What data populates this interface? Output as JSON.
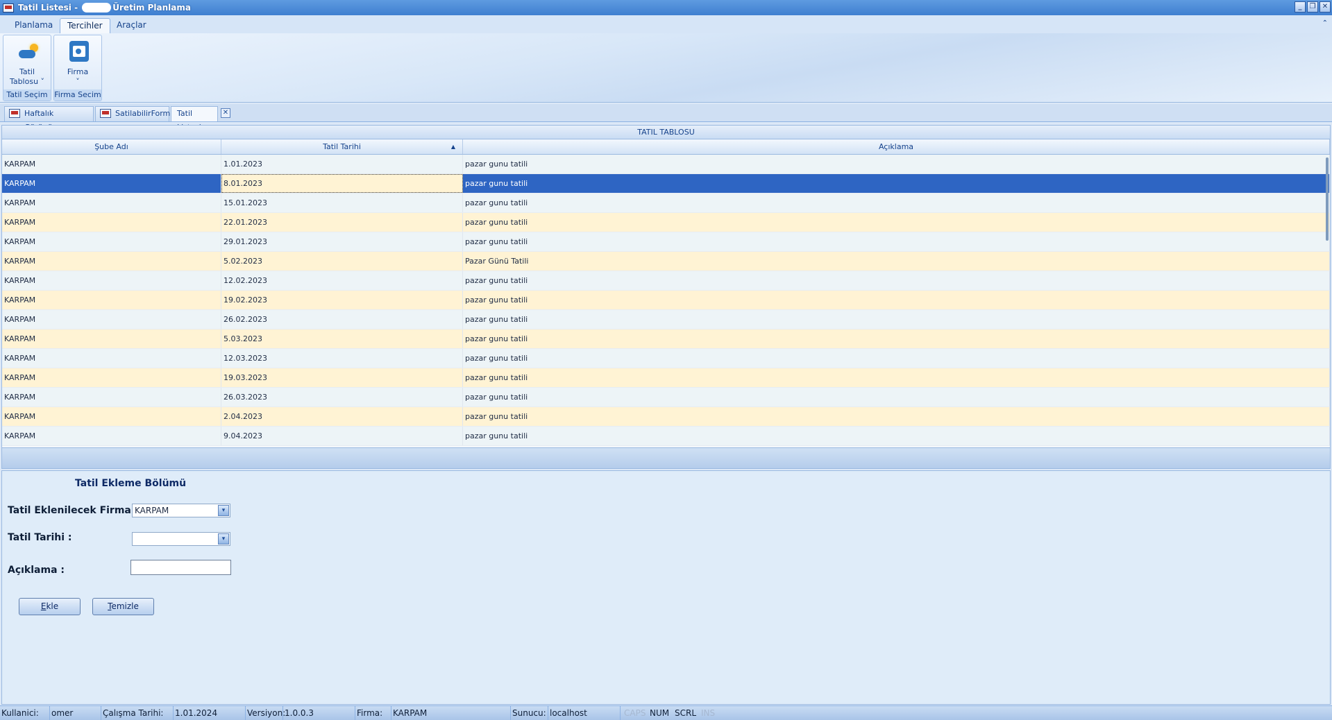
{
  "window": {
    "title_prefix": "Tatil Listesi -",
    "title_suffix": "Üretim Planlama",
    "minimize": "_",
    "restore": "❐",
    "close": "✕"
  },
  "ribbon": {
    "tabs": [
      "Planlama",
      "Tercihler",
      "Araçlar"
    ],
    "active_tab": "Tercihler",
    "collapse_glyph": "⌃",
    "groups": [
      {
        "button_line1": "Tatil",
        "button_line2": "Tablosu ˅",
        "label": "Tatil Seçim",
        "icon": "cloud-sun-icon"
      },
      {
        "button_line1": "Firma",
        "button_line2": "˅",
        "label": "Firma Secim",
        "icon": "company-document-icon"
      }
    ]
  },
  "doc_tabs": [
    {
      "label": "Haftalık Görünüm",
      "icon": "window-icon"
    },
    {
      "label": "SatilabilirForm",
      "icon": "window-icon"
    },
    {
      "label": "Tatil Listesi",
      "active": true
    }
  ],
  "doc_tab_close": "✕",
  "grid": {
    "title": "TATIL TABLOSU",
    "columns": [
      "Şube Adı",
      "Tatil Tarihi",
      "Açıklama"
    ],
    "sort_glyph": "▲",
    "selected_row": 1,
    "rows": [
      [
        "KARPAM",
        "1.01.2023",
        "pazar gunu tatili"
      ],
      [
        "KARPAM",
        "8.01.2023",
        "pazar gunu tatili"
      ],
      [
        "KARPAM",
        "15.01.2023",
        "pazar gunu tatili"
      ],
      [
        "KARPAM",
        "22.01.2023",
        "pazar gunu tatili"
      ],
      [
        "KARPAM",
        "29.01.2023",
        "pazar gunu tatili"
      ],
      [
        "KARPAM",
        "5.02.2023",
        "Pazar Günü Tatili"
      ],
      [
        "KARPAM",
        "12.02.2023",
        "pazar gunu tatili"
      ],
      [
        "KARPAM",
        "19.02.2023",
        "pazar gunu tatili"
      ],
      [
        "KARPAM",
        "26.02.2023",
        "pazar gunu tatili"
      ],
      [
        "KARPAM",
        "5.03.2023",
        "pazar gunu tatili"
      ],
      [
        "KARPAM",
        "12.03.2023",
        "pazar gunu tatili"
      ],
      [
        "KARPAM",
        "19.03.2023",
        "pazar gunu tatili"
      ],
      [
        "KARPAM",
        "26.03.2023",
        "pazar gunu tatili"
      ],
      [
        "KARPAM",
        "2.04.2023",
        "pazar gunu tatili"
      ],
      [
        "KARPAM",
        "9.04.2023",
        "pazar gunu tatili"
      ]
    ]
  },
  "form": {
    "title": "Tatil Ekleme Bölümü",
    "firma_label": "Tatil Eklenilecek Firma:",
    "firma_value": "KARPAM",
    "tarih_label": "Tatil Tarihi :",
    "tarih_value": "",
    "aciklama_label": "Açıklama :",
    "aciklama_value": "",
    "dropdown_glyph": "▾",
    "ekle_hotkey": "E",
    "ekle_rest": "kle",
    "temizle_hotkey": "T",
    "temizle_rest": "emizle"
  },
  "status": {
    "user_label": "Kullanici:",
    "user_value": "omer",
    "date_label": "Çalışma Tarihi:",
    "date_value": "1.01.2024",
    "version_label": "Versiyon:",
    "version_value": "1.0.0.3",
    "firm_label": "Firma:",
    "firm_value": "KARPAM",
    "server_label": "Sunucu:",
    "server_value": "localhost",
    "caps": "CAPS",
    "num": "NUM",
    "scrl": "SCRL",
    "ins": "INS"
  }
}
